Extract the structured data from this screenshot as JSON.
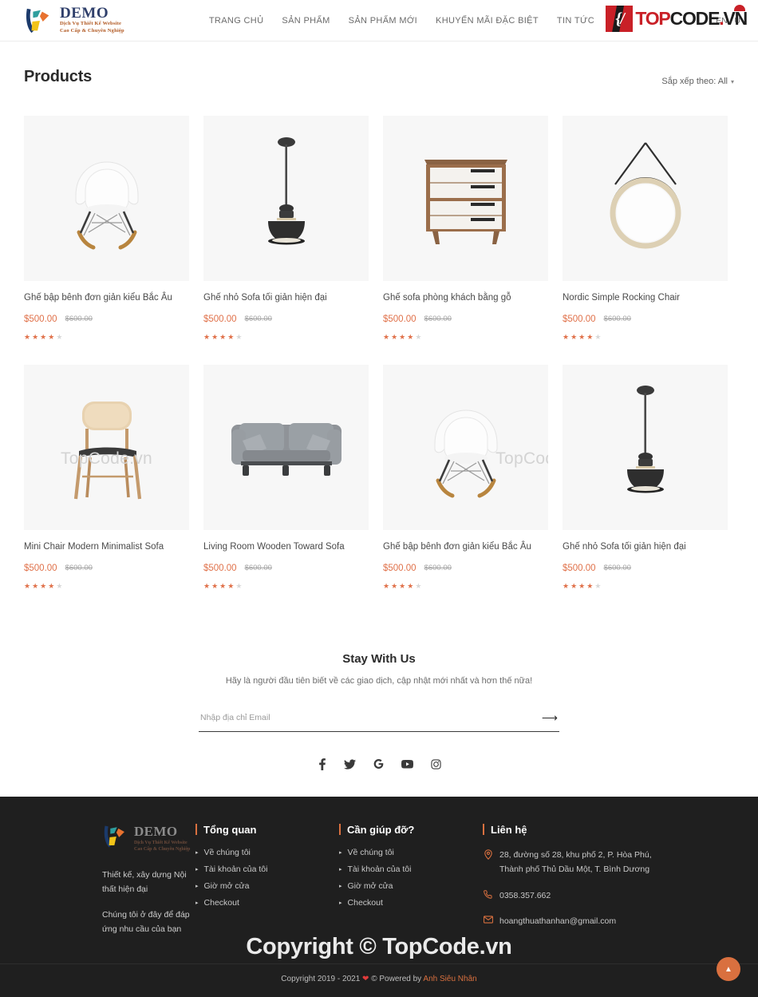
{
  "header": {
    "brand": {
      "title": "DEMO",
      "line1": "Dịch Vụ Thiết Kế Website",
      "line2": "Cao Cấp & Chuyên Nghiệp"
    },
    "nav": [
      {
        "label": "TRANG CHỦ"
      },
      {
        "label": "SẢN PHẨM"
      },
      {
        "label": "SẢN PHẨM MỚI"
      },
      {
        "label": "KHUYẾN MÃI ĐẶC BIỆT"
      },
      {
        "label": "TIN TỨC"
      }
    ],
    "lang": "EN / U",
    "watermark": {
      "w1": "TOP",
      "w2": "CODE",
      "w3": ".",
      "w4": "VN"
    }
  },
  "page": {
    "title": "Products",
    "sort_label": "Sắp xếp theo: All",
    "sort_chevron": "chevron-down-icon"
  },
  "products": [
    {
      "title": "Ghế bập bênh đơn giản kiểu Bắc Âu",
      "price": "$500.00",
      "old_price": "$600.00",
      "rating": 4,
      "image": "eames-rocking-chair-white",
      "watermark": ""
    },
    {
      "title": "Ghế nhỏ Sofa tối giản hiện đại",
      "price": "$500.00",
      "old_price": "$600.00",
      "rating": 4,
      "image": "pendant-lamp-black",
      "watermark": ""
    },
    {
      "title": "Ghế sofa phòng khách bằng gỗ",
      "price": "$500.00",
      "old_price": "$600.00",
      "rating": 4,
      "image": "wooden-dresser-white",
      "watermark": ""
    },
    {
      "title": "Nordic Simple Rocking Chair",
      "price": "$500.00",
      "old_price": "$600.00",
      "rating": 4,
      "image": "round-hanging-mirror",
      "watermark": ""
    },
    {
      "title": "Mini Chair Modern Minimalist Sofa",
      "price": "$500.00",
      "old_price": "$600.00",
      "rating": 4,
      "image": "wooden-dining-chair",
      "watermark": "TopCode.vn"
    },
    {
      "title": "Living Room Wooden Toward Sofa",
      "price": "$500.00",
      "old_price": "$600.00",
      "rating": 4,
      "image": "grey-two-seat-sofa",
      "watermark": ""
    },
    {
      "title": "Ghế bập bênh đơn giản kiểu Bắc Âu",
      "price": "$500.00",
      "old_price": "$600.00",
      "rating": 4,
      "image": "eames-rocking-chair-white",
      "watermark": "TopCode.vn"
    },
    {
      "title": "Ghế nhỏ Sofa tối giản hiện đại",
      "price": "$500.00",
      "old_price": "$600.00",
      "rating": 4,
      "image": "pendant-lamp-black",
      "watermark": ""
    }
  ],
  "newsletter": {
    "title": "Stay With Us",
    "subtitle": "Hãy là người đầu tiên biết về các giao dịch, cập nhật mới nhất và hơn thế nữa!",
    "placeholder": "Nhập địa chỉ Email",
    "value": "",
    "submit_icon": "arrow-right-icon"
  },
  "socials": [
    {
      "name": "facebook-icon"
    },
    {
      "name": "twitter-icon"
    },
    {
      "name": "google-icon"
    },
    {
      "name": "youtube-icon"
    },
    {
      "name": "instagram-icon"
    }
  ],
  "footer": {
    "brand": {
      "title": "DEMO",
      "line1": "Dịch Vụ Thiết Kế Website",
      "line2": "Cao Cấp & Chuyên Nghiệp"
    },
    "about_1": "Thiết kế, xây dựng Nội thất hiện đại",
    "about_2": "Chúng tôi ở đây để đáp ứng nhu cầu của bạn",
    "col_overview": {
      "title": "Tổng quan",
      "items": [
        "Về chúng tôi",
        "Tài khoản của tôi",
        "Giờ mở cửa",
        "Checkout"
      ]
    },
    "col_help": {
      "title": "Cần giúp đỡ?",
      "items": [
        "Về chúng tôi",
        "Tài khoản của tôi",
        "Giờ mở cửa",
        "Checkout"
      ]
    },
    "col_contact": {
      "title": "Liên hệ",
      "address": "28, đường số 28, khu phố 2, P. Hòa Phú, Thành phố Thủ Dầu Một, T. Bình Dương",
      "phone": "0358.357.662",
      "email": "hoangthuathanhan@gmail.com"
    },
    "copyright_prefix": "Copyright 2019 - 2021",
    "copyright_mid": "© Powered by",
    "copyright_by": "Anh Siêu Nhân",
    "watermark": "Copyright © TopCode.vn",
    "to_top_icon": "chevron-up-icon"
  },
  "colors": {
    "accent": "#d9703f",
    "price": "#e0714a",
    "footer_bg": "#1f1f1f",
    "brand_blue": "#2f3f6b",
    "watermark_red": "#c92027"
  }
}
